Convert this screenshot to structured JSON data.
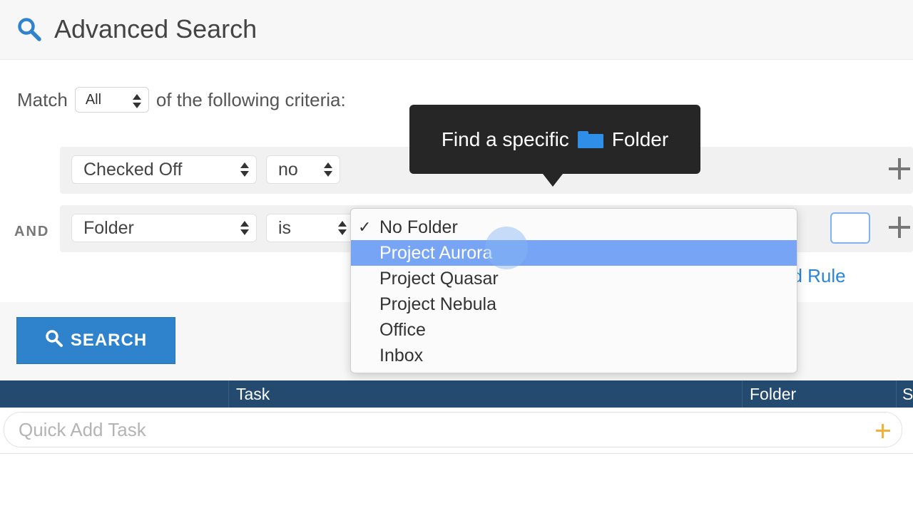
{
  "header": {
    "title": "Advanced Search",
    "icon": "search-icon"
  },
  "criteria": {
    "match_label": "Match",
    "match_value": "All",
    "match_suffix": "of the following criteria:",
    "rules": [
      {
        "conjunction": "",
        "field": "Checked Off",
        "operator": "no"
      },
      {
        "conjunction": "AND",
        "field": "Folder",
        "operator": "is"
      }
    ],
    "add_rule_label": "dd Rule"
  },
  "search_button": {
    "label": "SEARCH"
  },
  "table": {
    "columns": [
      "Task",
      "Folder",
      "S"
    ]
  },
  "quick_add": {
    "placeholder": "Quick Add Task"
  },
  "dropdown": {
    "selected": "No Folder",
    "highlighted": "Project Aurora",
    "options": [
      "No Folder",
      "Project Aurora",
      "Project Quasar",
      "Project Nebula",
      "Office",
      "Inbox"
    ]
  },
  "tooltip": {
    "text_before": "Find a specific",
    "text_after": "Folder",
    "icon": "folder-icon"
  },
  "colors": {
    "accent": "#2f82cc",
    "table_header": "#244a70",
    "highlight": "#78a4f5",
    "tooltip_bg": "#262626",
    "add_plus": "#f0b23b"
  }
}
